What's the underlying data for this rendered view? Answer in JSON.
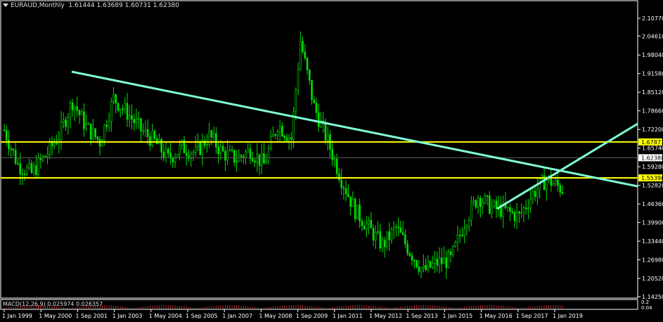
{
  "header": {
    "symbol": "EURAUD,Monthly",
    "ohlc": "1.61444 1.63689 1.60731 1.62380"
  },
  "indicator": {
    "macd_label": "MACD(12,26,9) 0.025974 0.026357"
  },
  "colors": {
    "background": "#000000",
    "candle": "#00e000",
    "trendline": "#7fffd4",
    "level": "#ffff00",
    "axis": "#ffffff",
    "grid_text": "#ffffff",
    "macd": "#ff5050"
  },
  "chart_data": {
    "type": "candlestick",
    "title": "EURAUD,Monthly",
    "y_ticks": [
      "2.10770",
      "2.04610",
      "1.98040",
      "1.91580",
      "1.85120",
      "1.78660",
      "1.72200",
      "1.65740",
      "1.59280",
      "1.52820",
      "1.46360",
      "1.39900",
      "1.33440",
      "1.26980",
      "1.20520",
      "1.14250"
    ],
    "y_tick_values": [
      2.1077,
      2.0461,
      1.9804,
      1.9158,
      1.8512,
      1.7866,
      1.722,
      1.6574,
      1.5928,
      1.5282,
      1.4636,
      1.399,
      1.3344,
      1.2698,
      1.2052,
      1.1425
    ],
    "ylim": [
      1.1425,
      2.1077
    ],
    "x_ticks": [
      "1 Jan 1999",
      "1 May 2000",
      "1 Sep 2001",
      "1 Jan 2003",
      "1 May 2004",
      "1 Sep 2005",
      "1 Jan 2007",
      "1 May 2008",
      "1 Sep 2009",
      "1 Jan 2011",
      "1 May 2012",
      "1 Sep 2013",
      "1 Jan 2015",
      "1 May 2016",
      "1 Sep 2017",
      "1 Jan 2019"
    ],
    "highlighted_levels": [
      {
        "label": "1.67871",
        "value": 1.67871,
        "color": "#ffff00"
      },
      {
        "label": "1.62380",
        "value": 1.6238,
        "color": "#808080"
      },
      {
        "label": "1.55396",
        "value": 1.55396,
        "color": "#ffff00"
      }
    ],
    "macd_axis": [
      "0.2",
      "0.04"
    ],
    "series": [
      {
        "month_index": 0,
        "value": 1.72
      },
      {
        "month_index": 6,
        "value": 1.6
      },
      {
        "month_index": 12,
        "value": 1.57
      },
      {
        "month_index": 18,
        "value": 1.63
      },
      {
        "month_index": 24,
        "value": 1.7
      },
      {
        "month_index": 30,
        "value": 1.82
      },
      {
        "month_index": 36,
        "value": 1.73
      },
      {
        "month_index": 42,
        "value": 1.68
      },
      {
        "month_index": 48,
        "value": 1.83
      },
      {
        "month_index": 54,
        "value": 1.78
      },
      {
        "month_index": 60,
        "value": 1.72
      },
      {
        "month_index": 66,
        "value": 1.68
      },
      {
        "month_index": 72,
        "value": 1.62
      },
      {
        "month_index": 78,
        "value": 1.66
      },
      {
        "month_index": 84,
        "value": 1.64
      },
      {
        "month_index": 90,
        "value": 1.7
      },
      {
        "month_index": 96,
        "value": 1.64
      },
      {
        "month_index": 102,
        "value": 1.62
      },
      {
        "month_index": 108,
        "value": 1.65
      },
      {
        "month_index": 114,
        "value": 1.6
      },
      {
        "month_index": 120,
        "value": 1.74
      },
      {
        "month_index": 126,
        "value": 1.69
      },
      {
        "month_index": 130,
        "value": 2.03
      },
      {
        "month_index": 136,
        "value": 1.8
      },
      {
        "month_index": 142,
        "value": 1.68
      },
      {
        "month_index": 148,
        "value": 1.55
      },
      {
        "month_index": 154,
        "value": 1.44
      },
      {
        "month_index": 160,
        "value": 1.38
      },
      {
        "month_index": 166,
        "value": 1.32
      },
      {
        "month_index": 172,
        "value": 1.38
      },
      {
        "month_index": 178,
        "value": 1.3
      },
      {
        "month_index": 184,
        "value": 1.23
      },
      {
        "month_index": 190,
        "value": 1.26
      },
      {
        "month_index": 196,
        "value": 1.27
      },
      {
        "month_index": 202,
        "value": 1.4
      },
      {
        "month_index": 208,
        "value": 1.49
      },
      {
        "month_index": 214,
        "value": 1.45
      },
      {
        "month_index": 220,
        "value": 1.44
      },
      {
        "month_index": 226,
        "value": 1.42
      },
      {
        "month_index": 232,
        "value": 1.5
      },
      {
        "month_index": 238,
        "value": 1.55
      },
      {
        "month_index": 244,
        "value": 1.52
      },
      {
        "month_index": 250,
        "value": 1.49
      },
      {
        "month_index": 256,
        "value": 1.46
      },
      {
        "month_index": 262,
        "value": 1.43
      },
      {
        "month_index": 268,
        "value": 1.5
      },
      {
        "month_index": 274,
        "value": 1.55
      },
      {
        "month_index": 280,
        "value": 1.58
      },
      {
        "month_index": 286,
        "value": 1.61
      },
      {
        "month_index": 292,
        "value": 1.59
      },
      {
        "month_index": 298,
        "value": 1.61
      },
      {
        "month_index": 304,
        "value": 1.64
      },
      {
        "month_index": 307,
        "value": 1.62
      }
    ]
  }
}
